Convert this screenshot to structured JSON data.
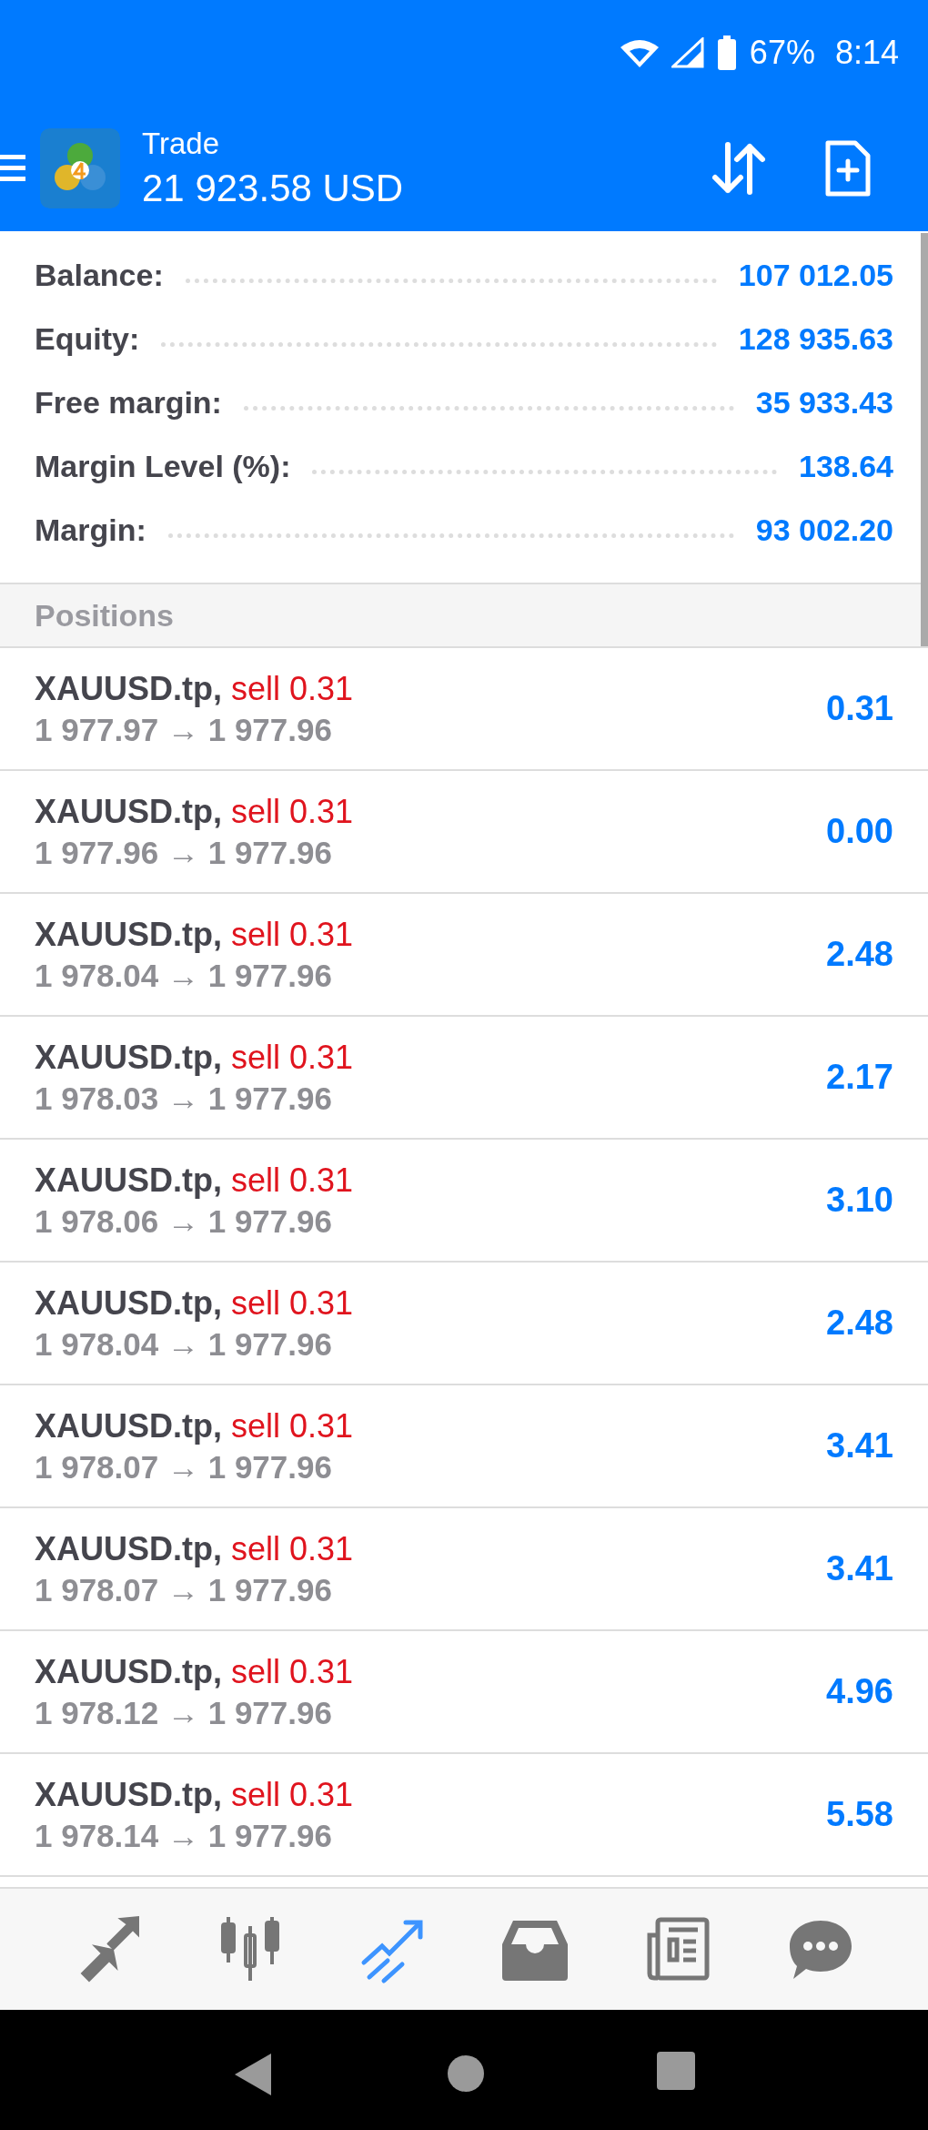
{
  "status_bar": {
    "battery": "67%",
    "time": "8:14"
  },
  "app_bar": {
    "title": "Trade",
    "subtitle": "21 923.58 USD"
  },
  "summary": [
    {
      "label": "Balance:",
      "value": "107 012.05"
    },
    {
      "label": "Equity:",
      "value": "128 935.63"
    },
    {
      "label": "Free margin:",
      "value": "35 933.43"
    },
    {
      "label": "Margin Level (%):",
      "value": "138.64"
    },
    {
      "label": "Margin:",
      "value": "93 002.20"
    }
  ],
  "positions_header": "Positions",
  "positions": [
    {
      "symbol": "XAUUSD.tp,",
      "side": "sell 0.31",
      "prices": "1 977.97 → 1 977.96",
      "profit": "0.31"
    },
    {
      "symbol": "XAUUSD.tp,",
      "side": "sell 0.31",
      "prices": "1 977.96 → 1 977.96",
      "profit": "0.00"
    },
    {
      "symbol": "XAUUSD.tp,",
      "side": "sell 0.31",
      "prices": "1 978.04 → 1 977.96",
      "profit": "2.48"
    },
    {
      "symbol": "XAUUSD.tp,",
      "side": "sell 0.31",
      "prices": "1 978.03 → 1 977.96",
      "profit": "2.17"
    },
    {
      "symbol": "XAUUSD.tp,",
      "side": "sell 0.31",
      "prices": "1 978.06 → 1 977.96",
      "profit": "3.10"
    },
    {
      "symbol": "XAUUSD.tp,",
      "side": "sell 0.31",
      "prices": "1 978.04 → 1 977.96",
      "profit": "2.48"
    },
    {
      "symbol": "XAUUSD.tp,",
      "side": "sell 0.31",
      "prices": "1 978.07 → 1 977.96",
      "profit": "3.41"
    },
    {
      "symbol": "XAUUSD.tp,",
      "side": "sell 0.31",
      "prices": "1 978.07 → 1 977.96",
      "profit": "3.41"
    },
    {
      "symbol": "XAUUSD.tp,",
      "side": "sell 0.31",
      "prices": "1 978.12 → 1 977.96",
      "profit": "4.96"
    },
    {
      "symbol": "XAUUSD.tp,",
      "side": "sell 0.31",
      "prices": "1 978.14 → 1 977.96",
      "profit": "5.58"
    }
  ],
  "bottom_nav": [
    {
      "kind": "quotes",
      "selected": false
    },
    {
      "kind": "chart",
      "selected": false
    },
    {
      "kind": "trade",
      "selected": true
    },
    {
      "kind": "history",
      "selected": false
    },
    {
      "kind": "news",
      "selected": false
    },
    {
      "kind": "messages",
      "selected": false
    }
  ]
}
